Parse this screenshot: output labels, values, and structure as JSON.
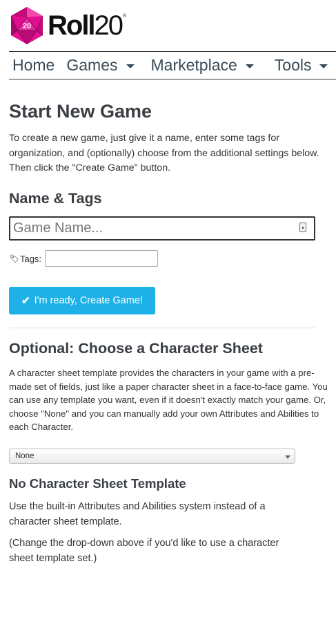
{
  "brand": {
    "die_number": "20",
    "name_bold": "Roll",
    "name_light": "20",
    "registered": "®",
    "colors": {
      "die_pink": "#e10f8f",
      "die_dark": "#9a0a62"
    }
  },
  "nav": {
    "items": [
      {
        "label": "Home",
        "has_dropdown": false
      },
      {
        "label": "Games",
        "has_dropdown": true
      },
      {
        "label": "Marketplace",
        "has_dropdown": true
      },
      {
        "label": "Tools",
        "has_dropdown": true
      }
    ]
  },
  "page": {
    "title": "Start New Game",
    "intro": "To create a new game, just give it a name, enter some tags for organization, and (optionally) choose from the additional settings below. Then click the \"Create Game\" button."
  },
  "name_tags": {
    "heading": "Name & Tags",
    "name_placeholder": "Game Name...",
    "name_value": "",
    "tags_label": "Tags:",
    "tags_value": "",
    "tag_icon": "tag-icon",
    "key_icon": "password-manager-key-icon"
  },
  "create_button": {
    "label": "I'm ready, Create Game!",
    "icon": "check-icon",
    "color": "#1db1e8"
  },
  "character_sheet": {
    "heading": "Optional: Choose a Character Sheet",
    "description": "A character sheet template provides the characters in your game with a pre-made set of fields, just like a paper character sheet in a face-to-face game. You can use any template you want, even if it doesn't exactly match your game. Or, choose \"None\" and you can manually add your own Attributes and Abilities to each Character.",
    "selected": "None",
    "no_sheet_heading": "No Character Sheet Template",
    "no_sheet_p1": "Use the built-in Attributes and Abilities system instead of a character sheet template.",
    "no_sheet_p2": "(Change the drop-down above if you'd like to use a character sheet template set.)"
  }
}
